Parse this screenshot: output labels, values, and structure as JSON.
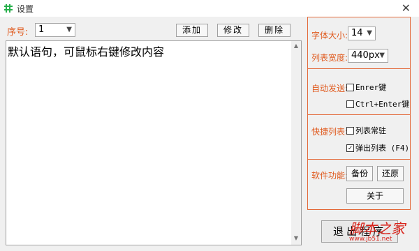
{
  "window": {
    "title": "设置",
    "close_glyph": "✕"
  },
  "left": {
    "serial_label": "序号:",
    "serial_value": "1",
    "add_button": "添加",
    "edit_button": "修改",
    "delete_button": "删除",
    "text_content": "默认语句，可鼠标右键修改内容"
  },
  "right": {
    "font_size_label": "字体大小:",
    "font_size_value": "14",
    "list_width_label": "列表宽度:",
    "list_width_value": "440px",
    "auto_send_label": "自动发送:",
    "enter_key": "Enrer键",
    "enter_key_checked": false,
    "ctrl_enter_key": "Ctrl+Enter键",
    "ctrl_enter_checked": false,
    "quick_list_label": "快捷列表:",
    "list_pinned": "列表常驻",
    "list_pinned_checked": false,
    "popup_list": "弹出列表 (F4)",
    "popup_list_checked": true,
    "software_label": "软件功能:",
    "backup_button": "备份",
    "restore_button": "还原",
    "about_button": "关于",
    "exit_button": "退出程序"
  },
  "watermark": {
    "text": "脚本之家",
    "url": "www.jb51.net"
  },
  "colors": {
    "accent": "#e05a1e",
    "divider": "#e36a3a",
    "watermark": "#d9251c"
  }
}
